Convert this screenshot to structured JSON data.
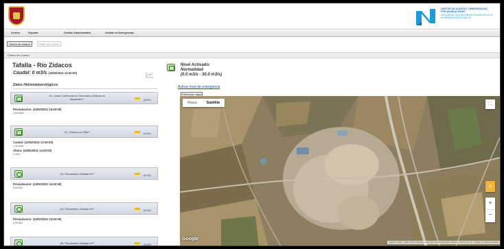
{
  "header": {
    "brand_lines": [
      "GESTOR DE ALERTAS Y EMERGENCIAS",
      "POR INUNDACIONES"
    ],
    "brand_sub_lines": [
      "UHOLDEEN GALDELENEAK KUDEATZEA ETA",
      "ALARMEN KUDEATZAILEA"
    ]
  },
  "menu": [
    "Archivo",
    "Exportar",
    "Gestión Administrativa",
    "Gestión de Emergencias"
  ],
  "toolbar": {
    "active_button": "Centro de control",
    "disabled_button": "Parte de Control"
  },
  "breadcrumb": "Centro de Control",
  "station": {
    "name": "Tafalla - Río Zidacos",
    "caudal_label": "Caudal: 0 m3/s",
    "caudal_time": "(10/02/2021 14:00:00)"
  },
  "datos_title": "Datos Hidrometeorológicos",
  "cards": [
    {
      "title_lines": [
        "-01- Zarna Cambronal en Garinoain y Zidacos en",
        "Barasoain**"
      ],
      "icon": "sensor-icon",
      "kuriv": "(KURV)",
      "readings": [
        {
          "label": "Precipitacion: (10/02/2021 14:00:00)",
          "value": "2.00 mm/h"
        }
      ]
    },
    {
      "title_lines": [
        "-02- Zidacos en Olite**"
      ],
      "icon": "sensor-icon",
      "kuriv": "(KURV)",
      "readings": [
        {
          "label": "Caudal: (10/02/2021 13:50:00)",
          "value": "2.31 m3/s"
        },
        {
          "label": "Altura: (10/02/2021 14:00:00)",
          "value": "2.34 m"
        }
      ]
    },
    {
      "title_lines": [
        "-03- Pluviómetro Gafadar Ini**"
      ],
      "icon": "rain-gauge-icon",
      "kuriv": "(KURV)",
      "readings": [
        {
          "label": "Precipitacion: (10/02/2021 14:00:00)",
          "value": "0.00 l/m2"
        }
      ]
    },
    {
      "title_lines": [
        "-04- Pluviómetro Gafadar Ini**"
      ],
      "icon": "rain-gauge-icon",
      "kuriv": "(KURV)",
      "readings": [
        {
          "label": "Precipitacion: (10/02/2021 14:00:00)",
          "value": "0.00 l/m2"
        }
      ]
    },
    {
      "title_lines": [
        "-05- Pluviómetro Gafadar Ini**"
      ],
      "icon": "rain-gauge-icon",
      "kuriv": "(KURV)",
      "readings": []
    }
  ],
  "nivel": {
    "title": "Nivel Activado:",
    "state": "Normalidad",
    "range": "(0.0 m3/s - 30.0 m3/s)",
    "activate_link": "Activar nivel de emergencia"
  },
  "map": {
    "refresh_button": "Refrescar mapa",
    "tab_map": "Mapa",
    "tab_satellite": "Satélite",
    "google_label": "Google",
    "attribution": "Imágenes ©2021 , CNES / Airbus, Datos del mapa ©2021 Instituto Geográfico Nacional · Términos de uso · Notificar un problema de Maps"
  }
}
